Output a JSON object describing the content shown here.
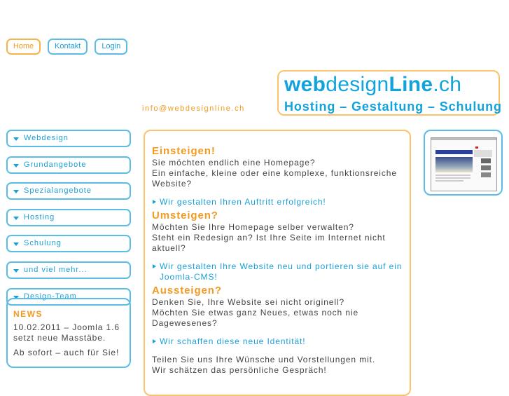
{
  "topnav": {
    "items": [
      {
        "label": "Home",
        "active": true
      },
      {
        "label": "Kontakt",
        "active": false
      },
      {
        "label": "Login",
        "active": false
      }
    ]
  },
  "logo": {
    "bold1": "web",
    "thin1": "design",
    "bold2": "Line",
    "thin2": ".ch",
    "tagline": "Hosting – Gestaltung – Schulung"
  },
  "contact": {
    "email": "info@webdesignline.ch"
  },
  "sidebar": {
    "items": [
      {
        "label": "Webdesign"
      },
      {
        "label": "Grundangebote"
      },
      {
        "label": "Spezialangebote"
      },
      {
        "label": "Hosting"
      },
      {
        "label": "Schulung"
      },
      {
        "label": "und viel mehr..."
      },
      {
        "label": "Design-Team"
      }
    ]
  },
  "news": {
    "title": "NEWS",
    "line1": "10.02.2011 – Joomla 1.6 setzt neue Masstäbe.",
    "line2": "Ab sofort – auch für Sie!"
  },
  "main": {
    "sections": [
      {
        "heading": "Einsteigen!",
        "lines": [
          "Sie möchten endlich eine Homepage?",
          "Ein einfache, kleine oder eine komplexe, funktionsreiche Website?"
        ],
        "link": "Wir gestalten Ihren Auftritt erfolgreich!"
      },
      {
        "heading": "Umsteigen?",
        "lines": [
          "Möchten Sie Ihre Homepage selber verwalten?",
          "Steht ein Redesign an? Ist Ihre Seite im Internet nicht aktuell?"
        ],
        "link": "Wir gestalten Ihre Website neu und portieren sie auf ein Joomla-CMS!"
      },
      {
        "heading": "Aussteigen?",
        "lines": [
          "Denken Sie, Ihre Website sei nicht originell?",
          "Möchten Sie etwas ganz Neues, etwas noch nie Dagewesenes?"
        ],
        "link": "Wir schaffen diese neue Identität!"
      }
    ],
    "closing": [
      "Teilen Sie uns Ihre Wünsche und Vorstellungen mit.",
      "Wir schätzen das persönliche Gespräch!"
    ]
  },
  "thumbnail": {
    "icon": "website-screenshot-thumbnail"
  }
}
